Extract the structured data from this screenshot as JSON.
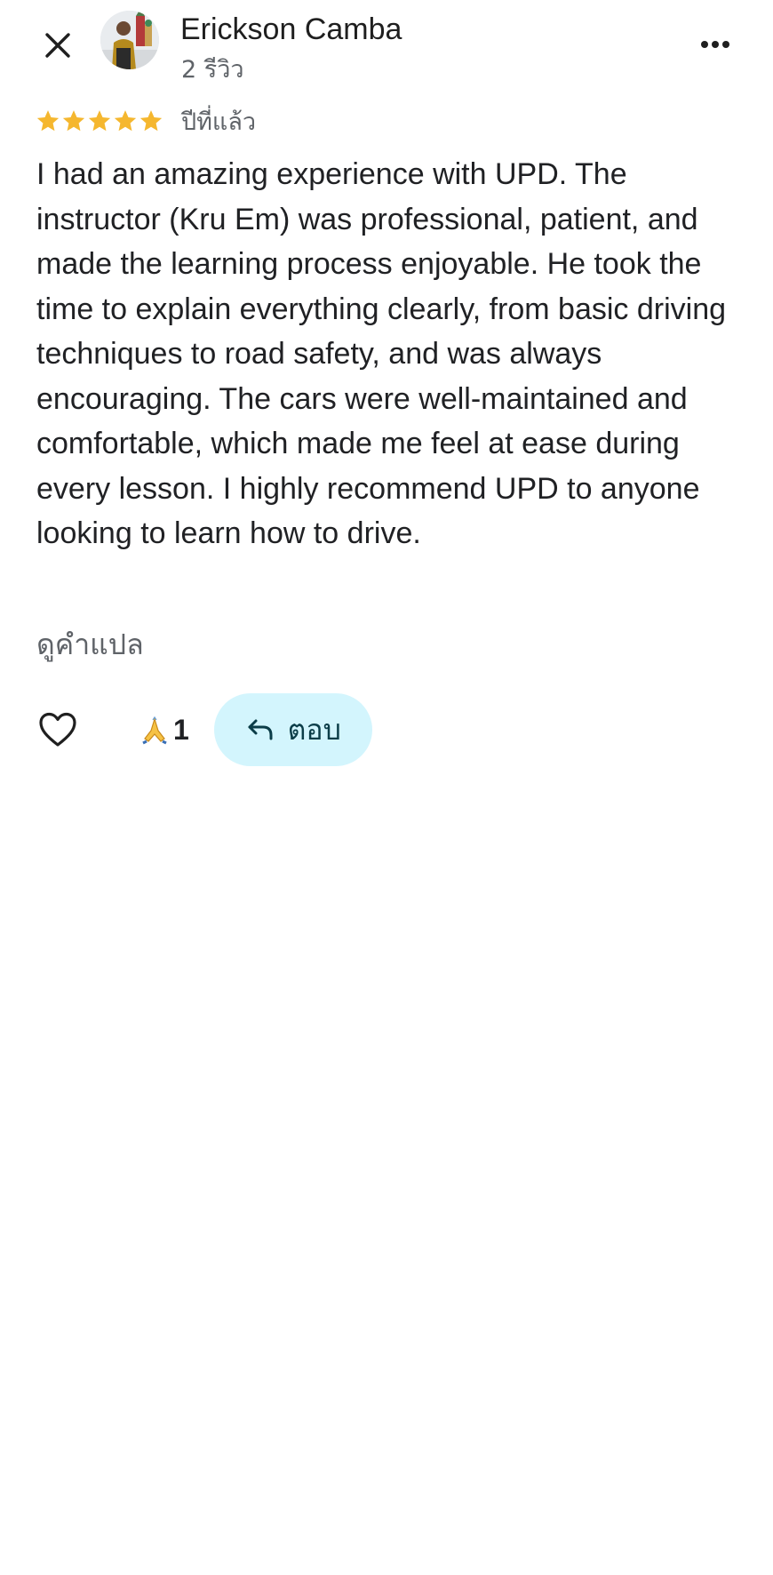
{
  "reviewer": {
    "name": "Erickson Camba",
    "review_count": "2 รีวิว"
  },
  "review": {
    "rating": 5,
    "max_rating": 5,
    "date": "ปีที่แล้ว",
    "text": "I had an amazing experience with UPD. The instructor (Kru Em) was professional, patient, and made the learning process enjoyable. He took the time to explain everything clearly, from basic driving techniques to road safety, and was always encouraging. The cars were well-maintained and comfortable, which made me feel at ease during every lesson. I highly recommend UPD to anyone looking to learn how to drive.",
    "translate_label": "ดูคำแปล"
  },
  "actions": {
    "reaction_emoji": "🙏",
    "reaction_count": "1",
    "reply_label": "ตอบ"
  },
  "icons": {
    "close": "close-icon",
    "more": "more-options-icon",
    "star": "star-icon",
    "like": "heart-outline-icon",
    "reply": "reply-arrow-icon"
  },
  "colors": {
    "star": "#f5b72f",
    "reply_button_bg": "#d3f5fd",
    "reply_text": "#0b3d48",
    "secondary_text": "#5f6368"
  }
}
